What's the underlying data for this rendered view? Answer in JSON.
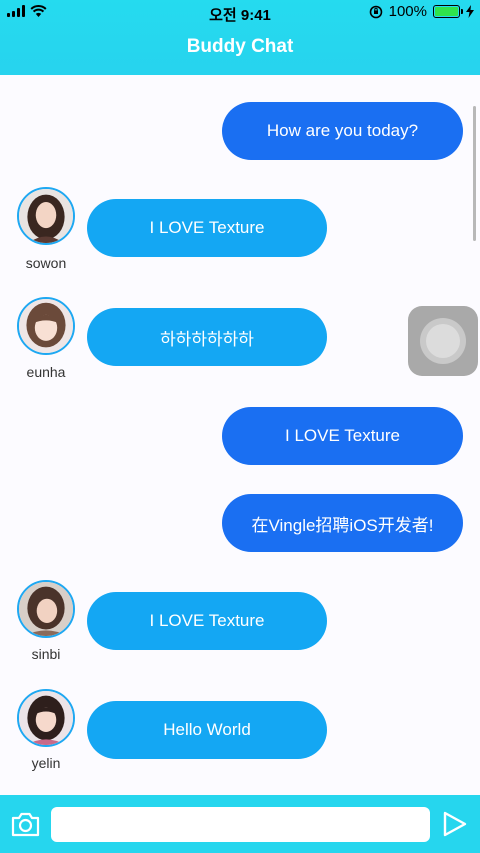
{
  "status_bar": {
    "time": "오전 9:41",
    "battery": "100%",
    "battery_level": 1.0
  },
  "header": {
    "title": "Buddy Chat"
  },
  "messages": [
    {
      "from": "me",
      "text": "How are you today?"
    },
    {
      "from": "them",
      "user": "sowon",
      "text": "I LOVE Texture"
    },
    {
      "from": "them",
      "user": "eunha",
      "text": "하하하하하하"
    },
    {
      "from": "me",
      "text": "I LOVE Texture"
    },
    {
      "from": "me",
      "text": "在Vingle招聘iOS开发者!"
    },
    {
      "from": "them",
      "user": "sinbi",
      "text": "I LOVE Texture"
    },
    {
      "from": "them",
      "user": "yelin",
      "text": "Hello World"
    }
  ],
  "composer": {
    "value": "",
    "placeholder": ""
  },
  "icons": {
    "camera": "camera-icon",
    "send": "send-icon",
    "assistive_touch": "assistive-touch-icon"
  },
  "colors": {
    "header": "#26d6ee",
    "my_bubble": "#1a6ff2",
    "their_bubble": "#14a7f3"
  }
}
